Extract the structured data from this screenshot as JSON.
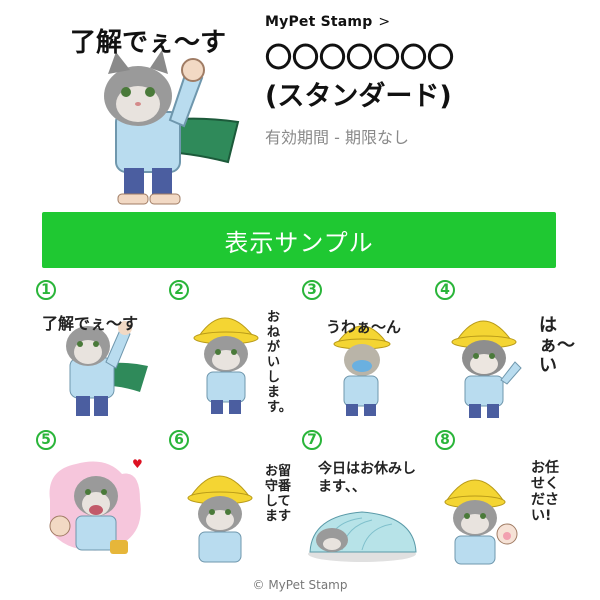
{
  "header": {
    "breadcrumb": "MyPet Stamp",
    "title_line1": "〇〇〇〇〇〇〇",
    "title_line2": "(スタンダード)",
    "validity": "有効期間 - 期限なし",
    "main_sticker_text": "了解でぇ〜す"
  },
  "sample_button": "表示サンプル",
  "stickers": [
    {
      "number": "1",
      "text": "了解でぇ〜す"
    },
    {
      "number": "2",
      "text": "おねがいします。"
    },
    {
      "number": "3",
      "text": "うわぁ〜ん"
    },
    {
      "number": "4",
      "text": "はぁ〜い"
    },
    {
      "number": "5",
      "text": ""
    },
    {
      "number": "6",
      "text": "お留守番してます"
    },
    {
      "number": "7",
      "text": "今日はお休みします、、"
    },
    {
      "number": "8",
      "text": "お任せください!"
    }
  ],
  "footer": {
    "copyright": "© MyPet Stamp"
  },
  "colors": {
    "accent_green": "#1fc832",
    "number_green": "#2ab53a",
    "hat_yellow": "#f4d533",
    "shirt_blue": "#b9dcef"
  }
}
